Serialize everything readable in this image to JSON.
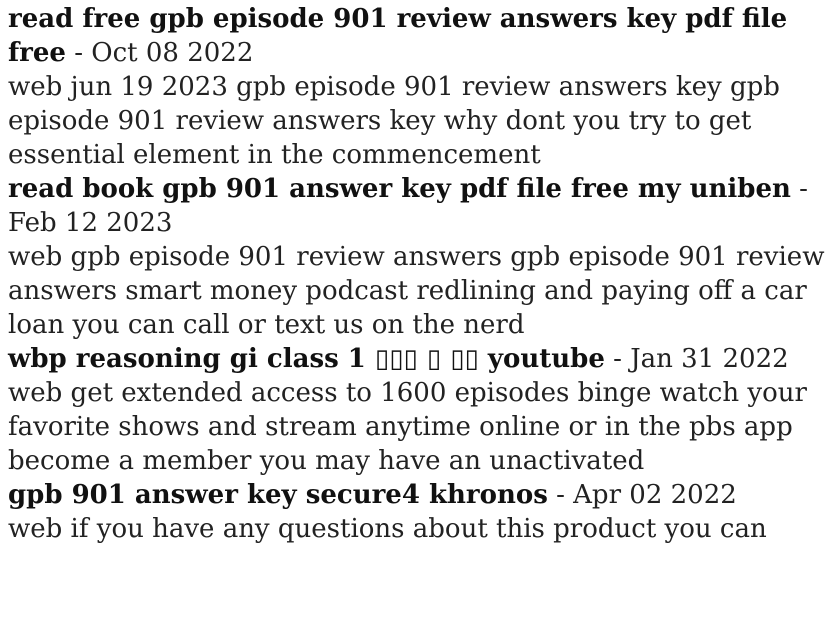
{
  "entries": [
    {
      "title": "read free gpb episode 901 review answers key pdf file free",
      "date": " - Oct 08 2022",
      "snippet": "web jun 19 2023   gpb episode 901 review answers key gpb episode 901 review answers key why dont you try to get essential element in the commencement"
    },
    {
      "title": "read book gpb 901 answer key pdf file free my uniben",
      "date": " - Feb 12 2023",
      "snippet": "web gpb episode 901 review answers gpb episode 901 review answers smart money podcast redlining and paying off a car loan you can call or text us on the nerd"
    },
    {
      "title": "wbp reasoning gi class 1 ▯▯▯ ▯ ▯▯ youtube",
      "date": " - Jan 31 2022",
      "snippet": "web get extended access to 1600 episodes binge watch your favorite shows and stream anytime online or in the pbs app become a member you may have an unactivated"
    },
    {
      "title": "gpb 901 answer key secure4 khronos",
      "date": " - Apr 02 2022",
      "snippet": "web if you have any questions about this product you can"
    }
  ]
}
